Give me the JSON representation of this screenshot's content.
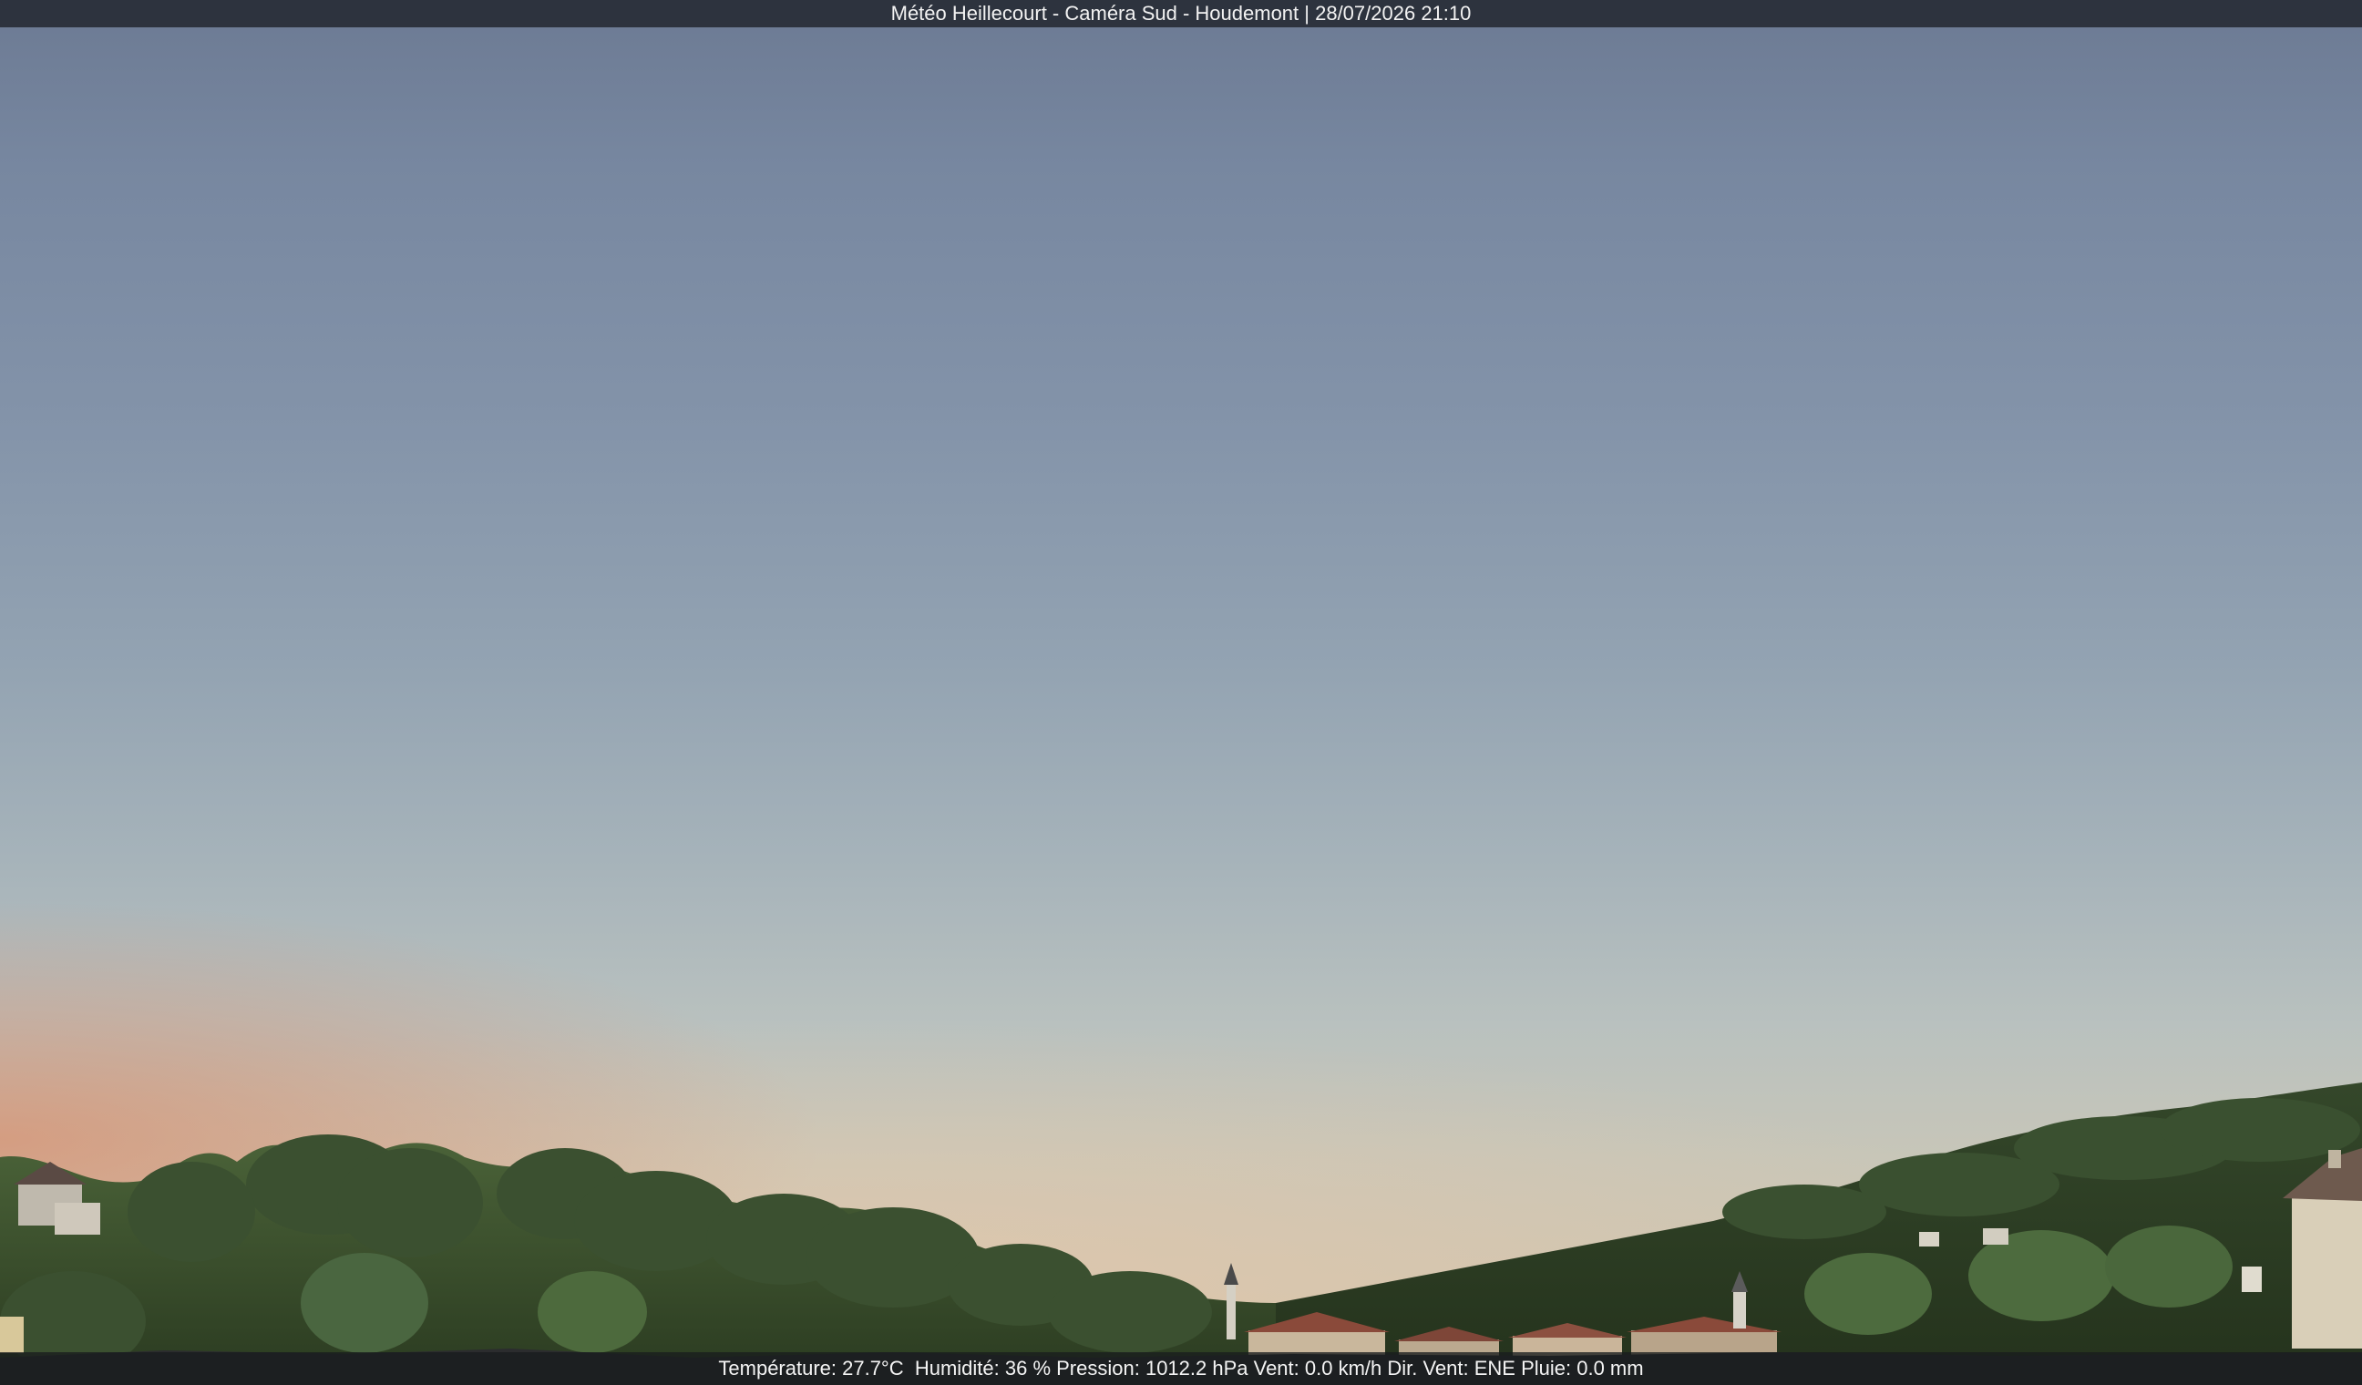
{
  "header": {
    "caption": "Météo Heillecourt - Caméra Sud - Houdemont | 28/07/2026 21:10"
  },
  "footer": {
    "weather_line": "Température: 27.7°C  Humidité: 36 % Pression: 1012.2 hPa Vent: 0.0 km/h Dir. Vent: ENE Pluie: 0.0 mm"
  },
  "colors": {
    "sky_top": "#6c7a93",
    "sky_horizon": "#d3c2ab",
    "sunset_glow": "#d6967a",
    "foliage_dark": "#2c3b22",
    "foliage_mid": "#3f5530",
    "roof_tile": "#8a4a3a",
    "house_wall": "#d9cfb8"
  }
}
